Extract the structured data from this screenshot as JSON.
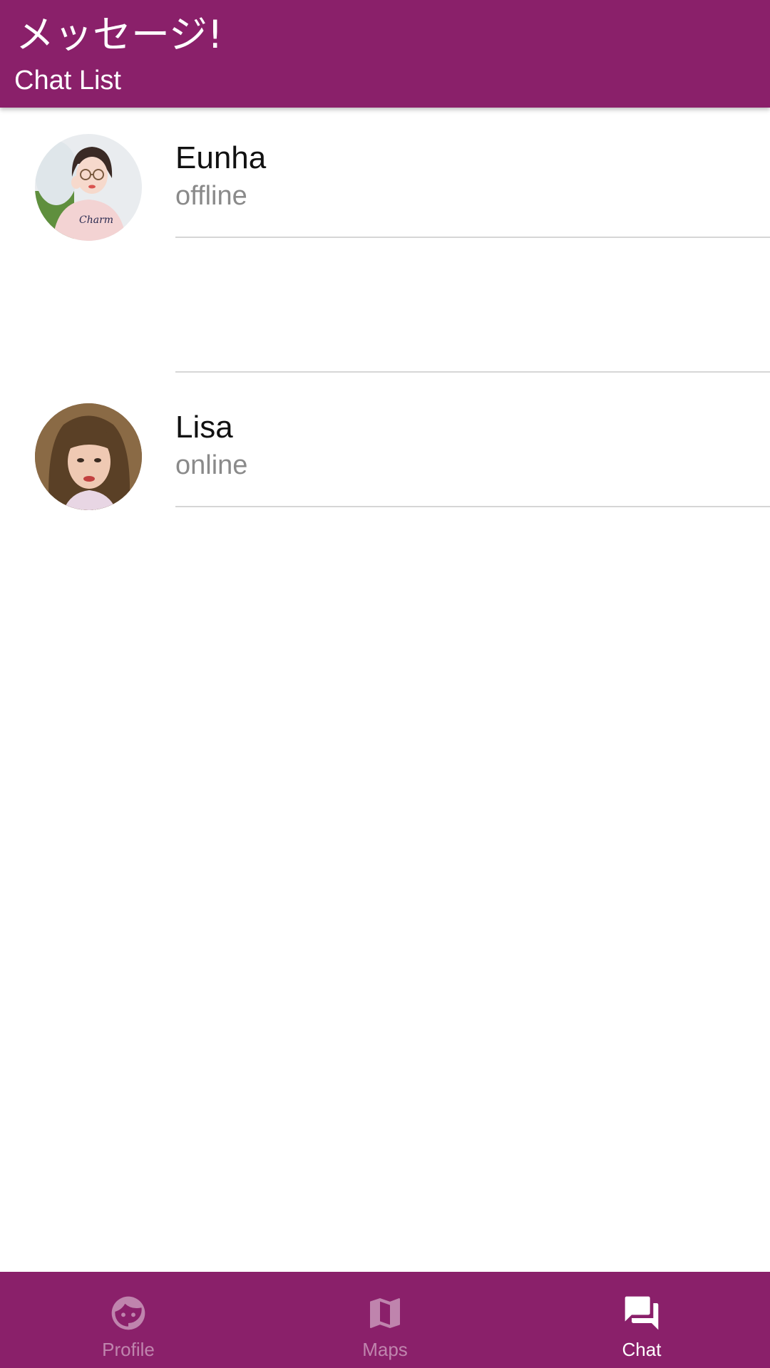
{
  "app_bar": {
    "title": "メッセージ!",
    "subtitle": "Chat List"
  },
  "chats": [
    {
      "name": "Eunha",
      "status": "offline",
      "avatar_icon": "avatar-photo"
    },
    {
      "name": "Lisa",
      "status": "online",
      "avatar_icon": "avatar-photo"
    }
  ],
  "bottom_nav": {
    "items": [
      {
        "label": "Profile",
        "icon": "face-icon",
        "active": false
      },
      {
        "label": "Maps",
        "icon": "map-icon",
        "active": false
      },
      {
        "label": "Chat",
        "icon": "forum-icon",
        "active": true
      }
    ]
  },
  "colors": {
    "primary": "#8a206a",
    "divider": "#d6d6d6",
    "status_text": "#8a8a8a"
  }
}
